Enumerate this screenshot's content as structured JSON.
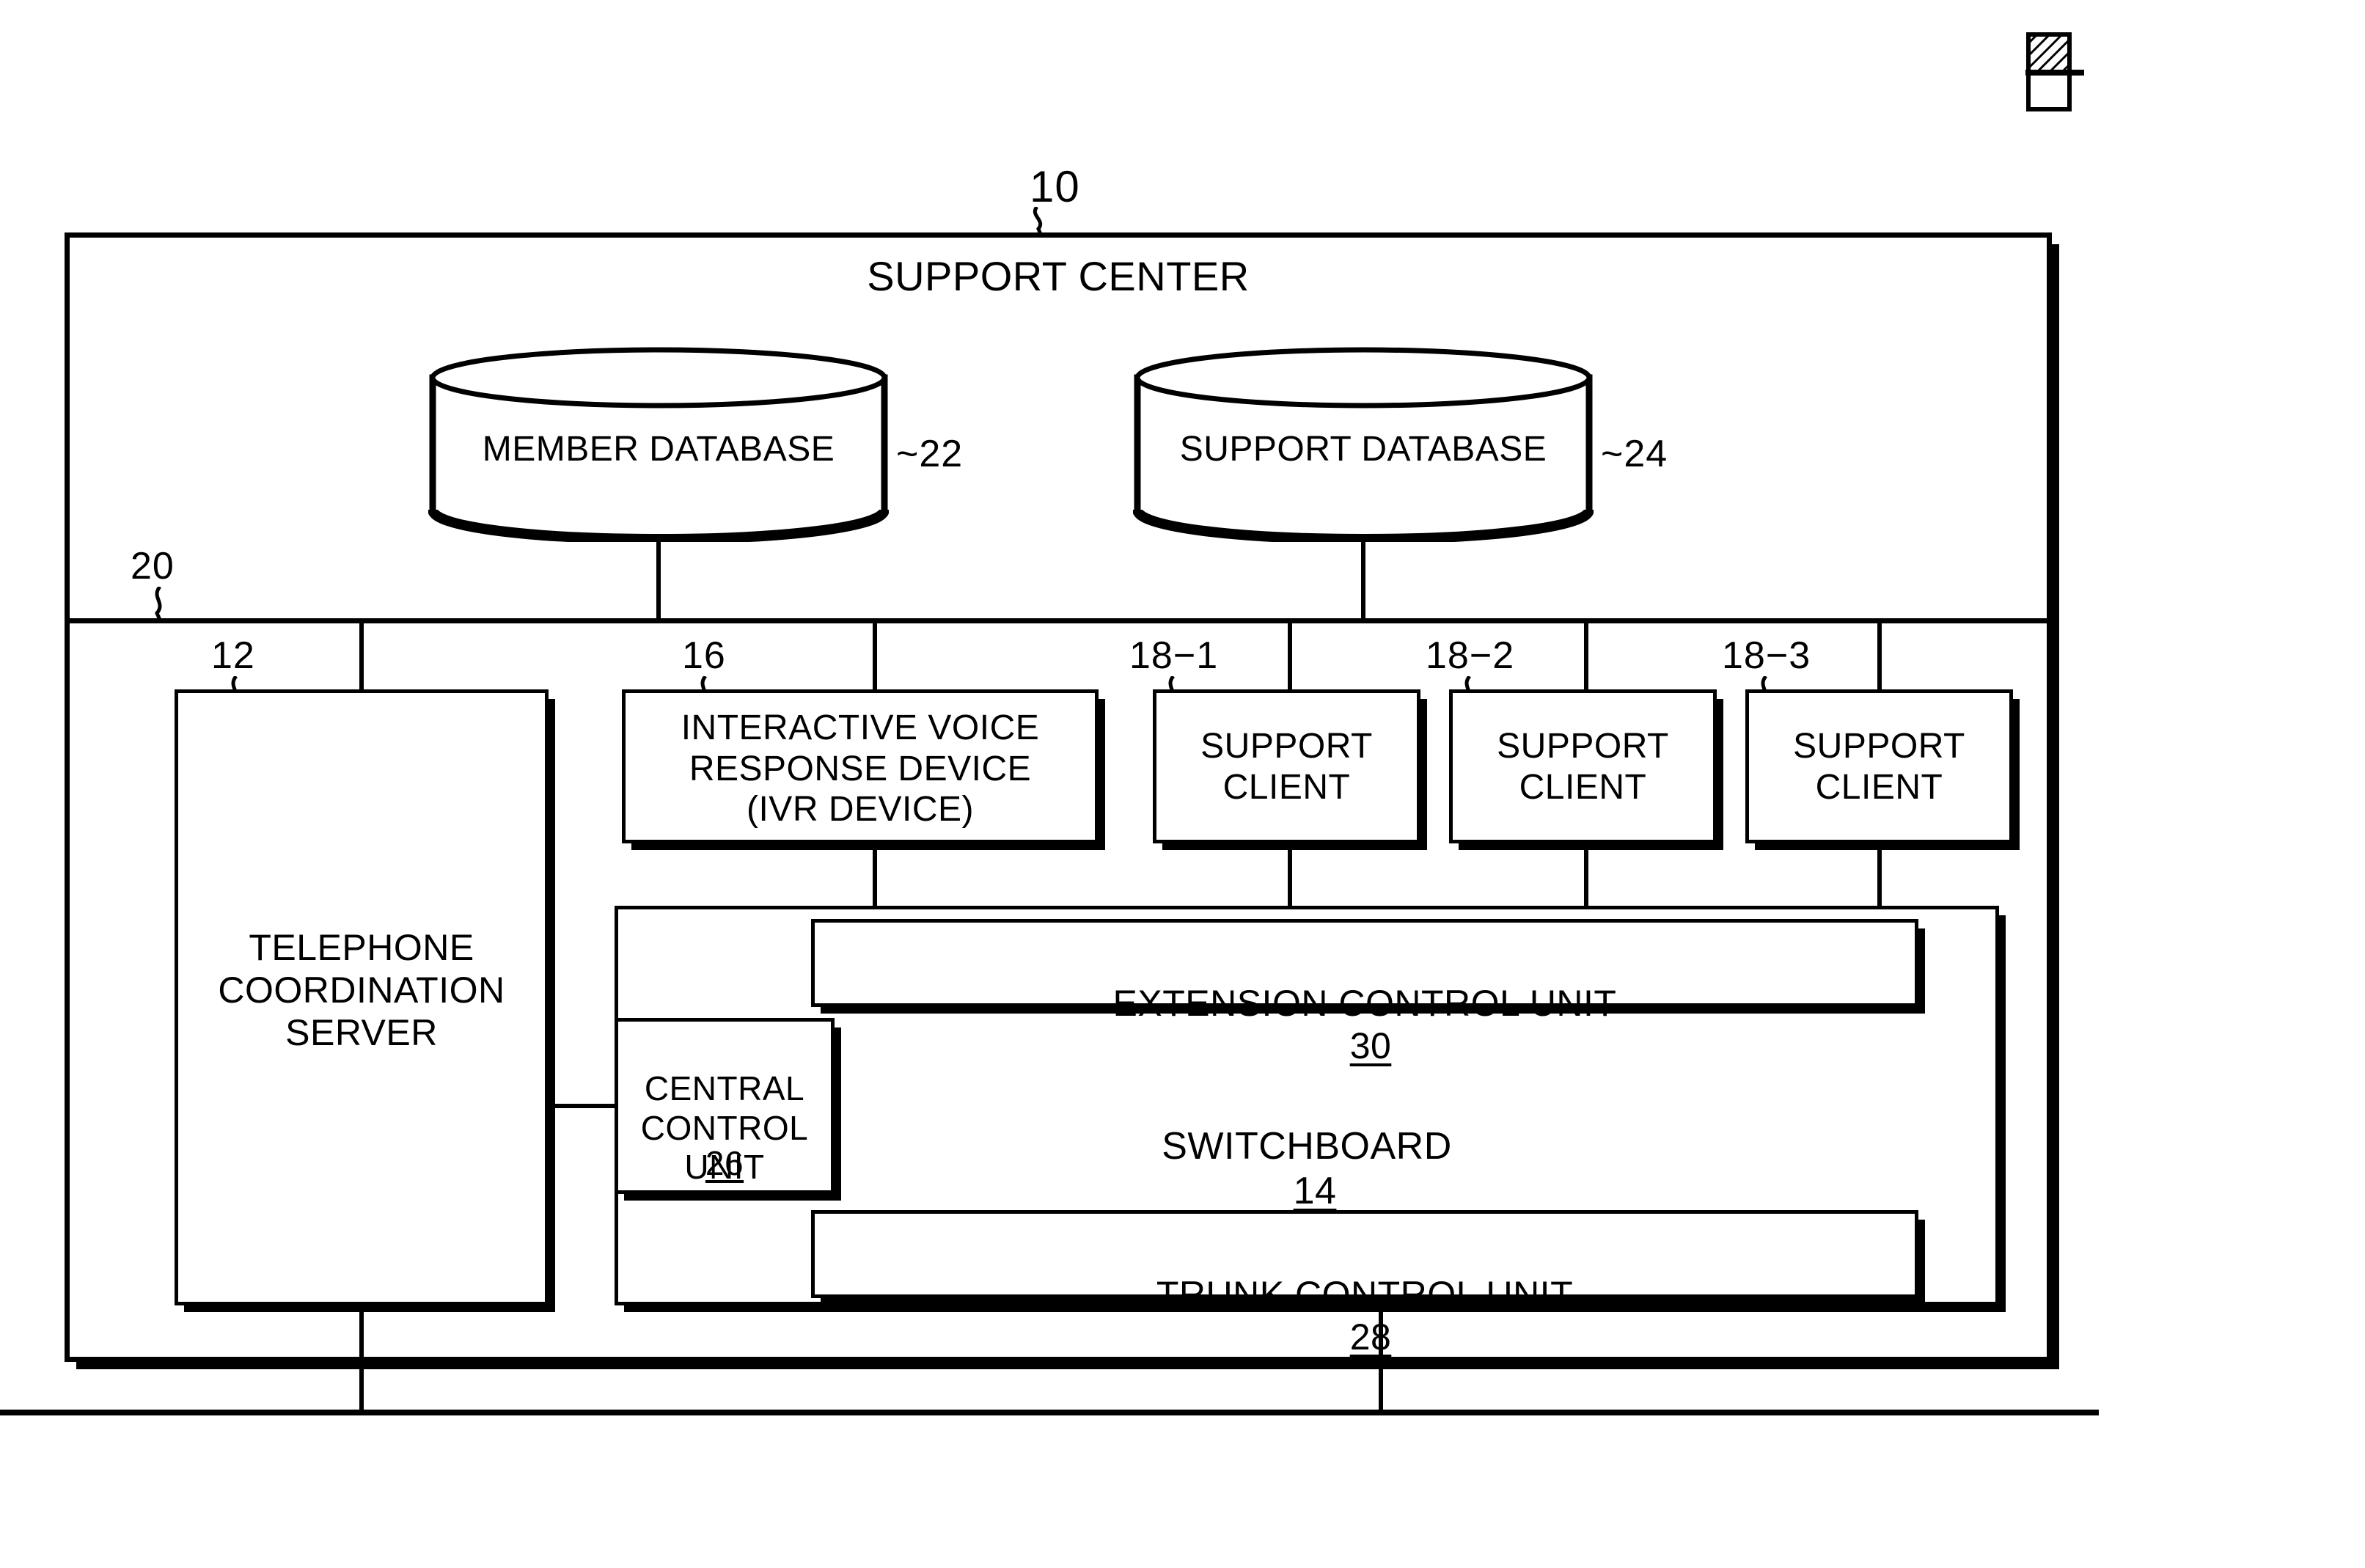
{
  "figure": {
    "outer_box_label": "SUPPORT CENTER",
    "outer_box_ref": "10",
    "bus_ref": "20",
    "corner_mark": "hatched-square-registration-mark"
  },
  "databases": [
    {
      "name": "member-database",
      "label": "MEMBER DATABASE",
      "ref": "~22"
    },
    {
      "name": "support-database",
      "label": "SUPPORT DATABASE",
      "ref": "~24"
    }
  ],
  "nodes": {
    "telephone_coordination_server": {
      "label": "TELEPHONE\nCOORDINATION\nSERVER",
      "ref": "12"
    },
    "ivr_device": {
      "label": "INTERACTIVE VOICE\nRESPONSE DEVICE\n(IVR DEVICE)",
      "ref": "16"
    },
    "support_clients": [
      {
        "label": "SUPPORT\nCLIENT",
        "ref": "18−1"
      },
      {
        "label": "SUPPORT\nCLIENT",
        "ref": "18−2"
      },
      {
        "label": "SUPPORT\nCLIENT",
        "ref": "18−3"
      }
    ]
  },
  "switchboard": {
    "label": "SWITCHBOARD",
    "ref": "14",
    "extension_control_unit": {
      "label": "EXTENSION CONTROL UNIT",
      "ref": "30"
    },
    "central_control_unit": {
      "label": "CENTRAL\nCONTROL\nUNIT",
      "ref": "26"
    },
    "trunk_control_unit": {
      "label": "TRUNK CONTROL UNIT",
      "ref": "28"
    }
  },
  "colors": {
    "ink": "#000000",
    "paper": "#ffffff"
  }
}
